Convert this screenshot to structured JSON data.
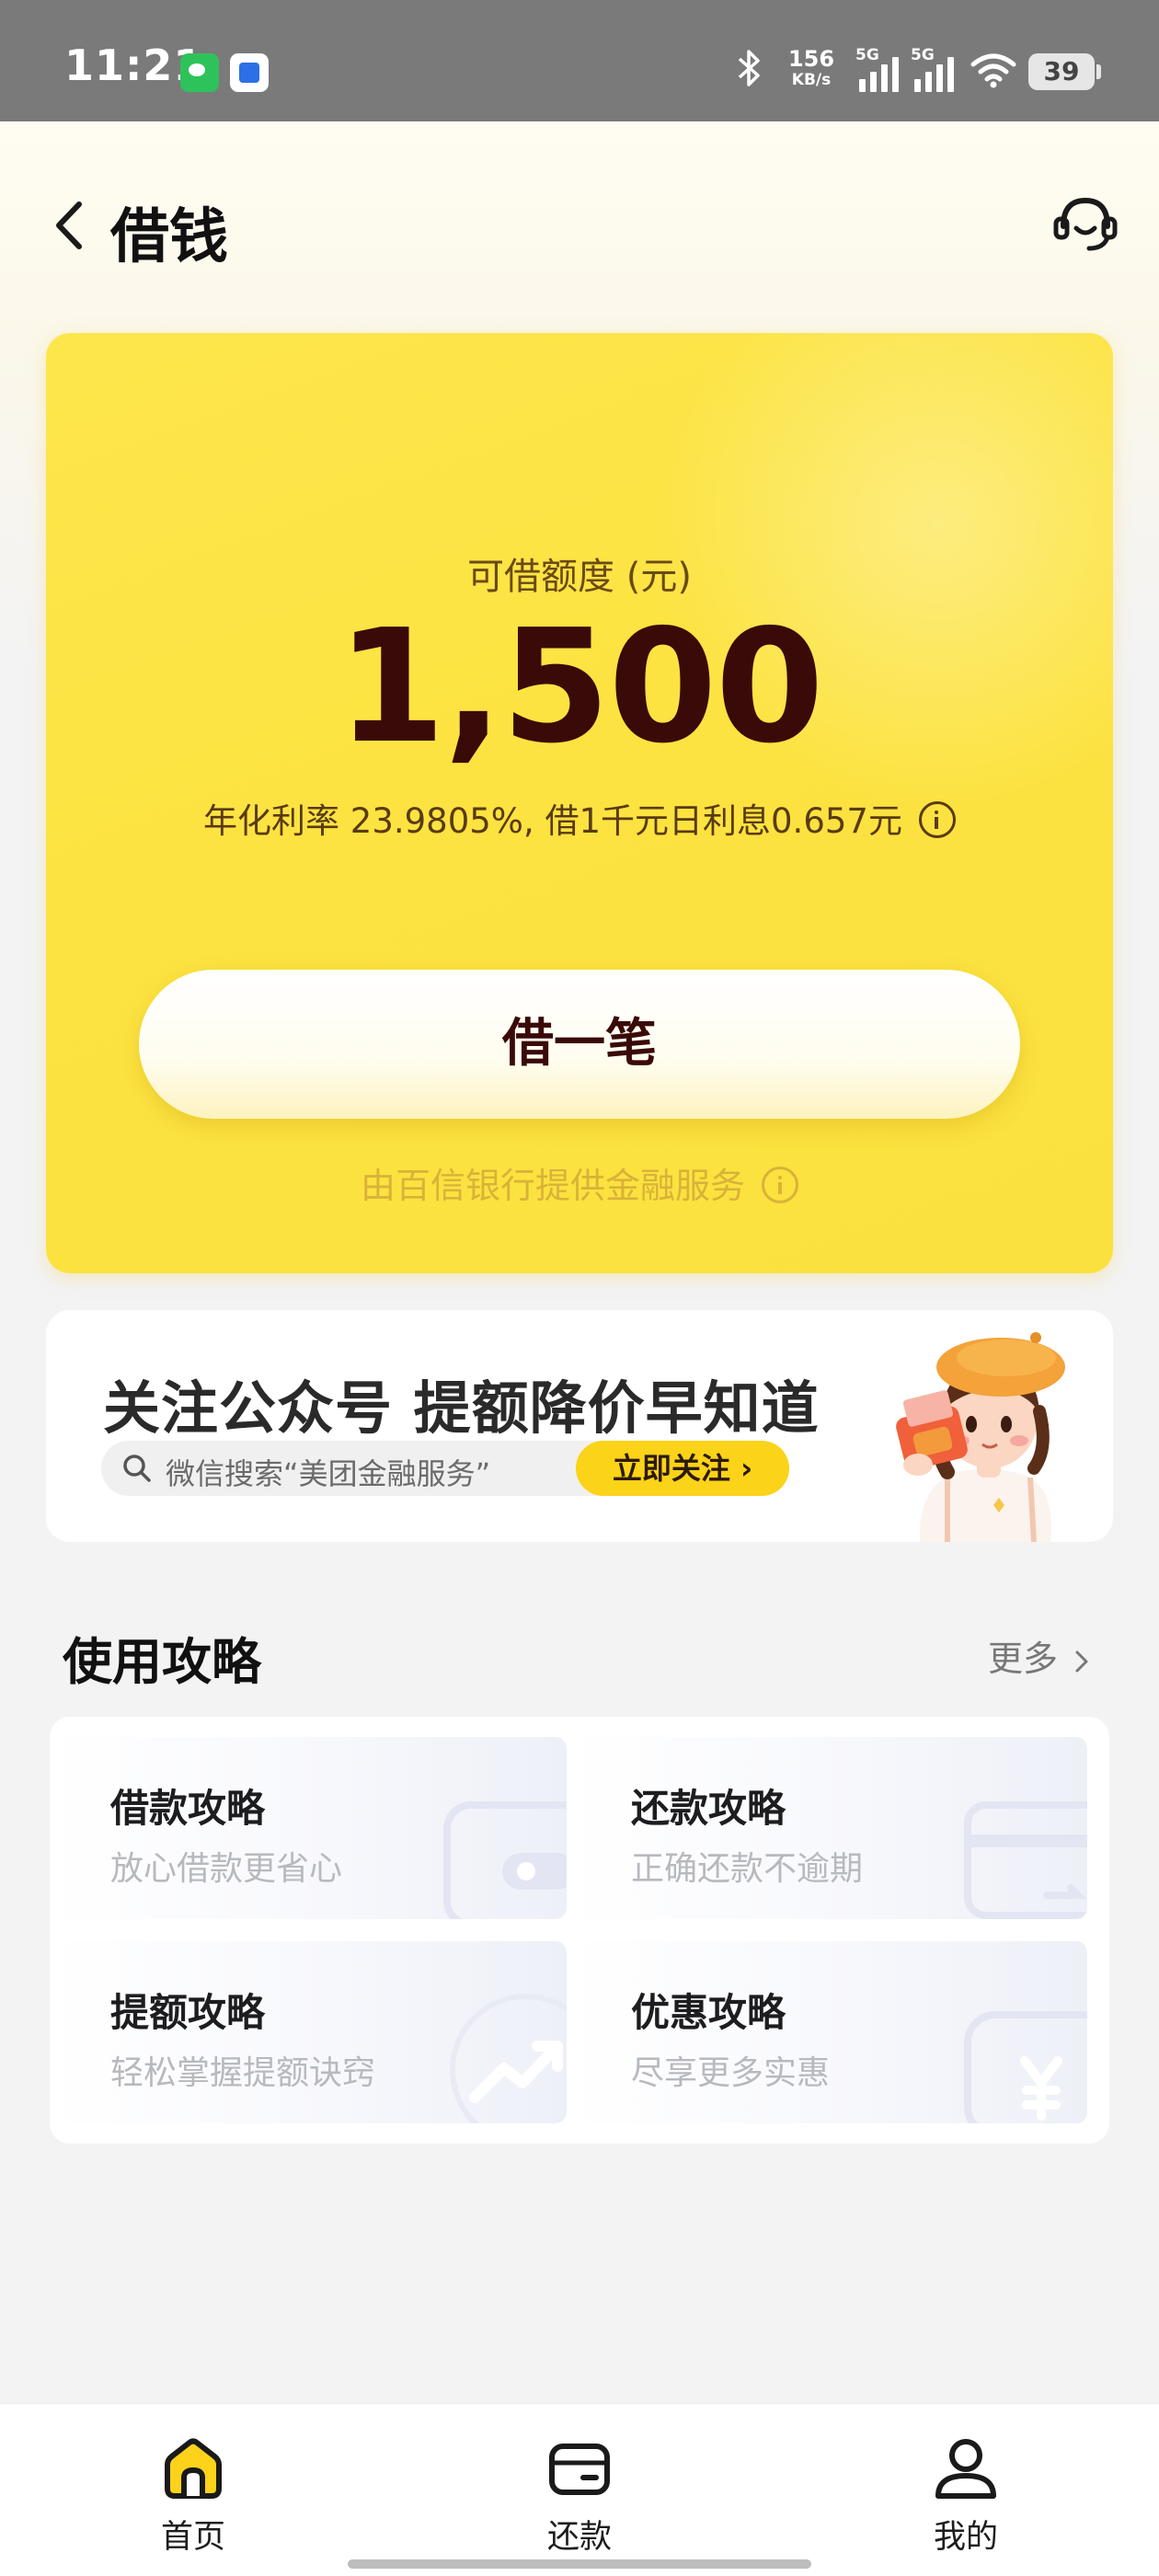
{
  "status_bar": {
    "time": "11:21",
    "speed_value": "156",
    "speed_unit": "KB/s",
    "signal1_tag": "5G",
    "signal2_tag": "5G",
    "battery": "39",
    "icons": [
      "wechat-icon",
      "app-notification-icon",
      "bluetooth-icon",
      "signal-icon",
      "wifi-icon",
      "battery-icon"
    ]
  },
  "header": {
    "title": "借钱",
    "icons": [
      "back-icon",
      "customer-service-icon"
    ]
  },
  "credit_card": {
    "limit_label": "可借额度 (元)",
    "limit_amount": "1,500",
    "rate_text": "年化利率 23.9805%, 借1千元日利息0.657元",
    "borrow_button": "借一笔",
    "provider_text": "由百信银行提供金融服务"
  },
  "follow_banner": {
    "title": "关注公众号 提额降价早知道",
    "search_text": "微信搜索“美团金融服务”",
    "button_label": "立即关注 ›"
  },
  "tips": {
    "title": "使用攻略",
    "more": "更多",
    "items": [
      {
        "title": "借款攻略",
        "subtitle": "放心借款更省心",
        "icon": "wallet-icon"
      },
      {
        "title": "还款攻略",
        "subtitle": "正确还款不逾期",
        "icon": "card-icon"
      },
      {
        "title": "提额攻略",
        "subtitle": "轻松掌握提额诀窍",
        "icon": "trend-up-icon"
      },
      {
        "title": "优惠攻略",
        "subtitle": "尽享更多实惠",
        "icon": "coupon-icon"
      }
    ]
  },
  "bottom_nav": {
    "items": [
      {
        "label": "首页",
        "icon": "home-icon",
        "active": true
      },
      {
        "label": "还款",
        "icon": "repay-wallet-icon",
        "active": false
      },
      {
        "label": "我的",
        "icon": "profile-icon",
        "active": false
      }
    ]
  },
  "colors": {
    "card_yellow": "#fce341",
    "amount_dark": "#3a0a08",
    "follow_button": "#fbd318",
    "provider_text": "#d9b23a"
  }
}
